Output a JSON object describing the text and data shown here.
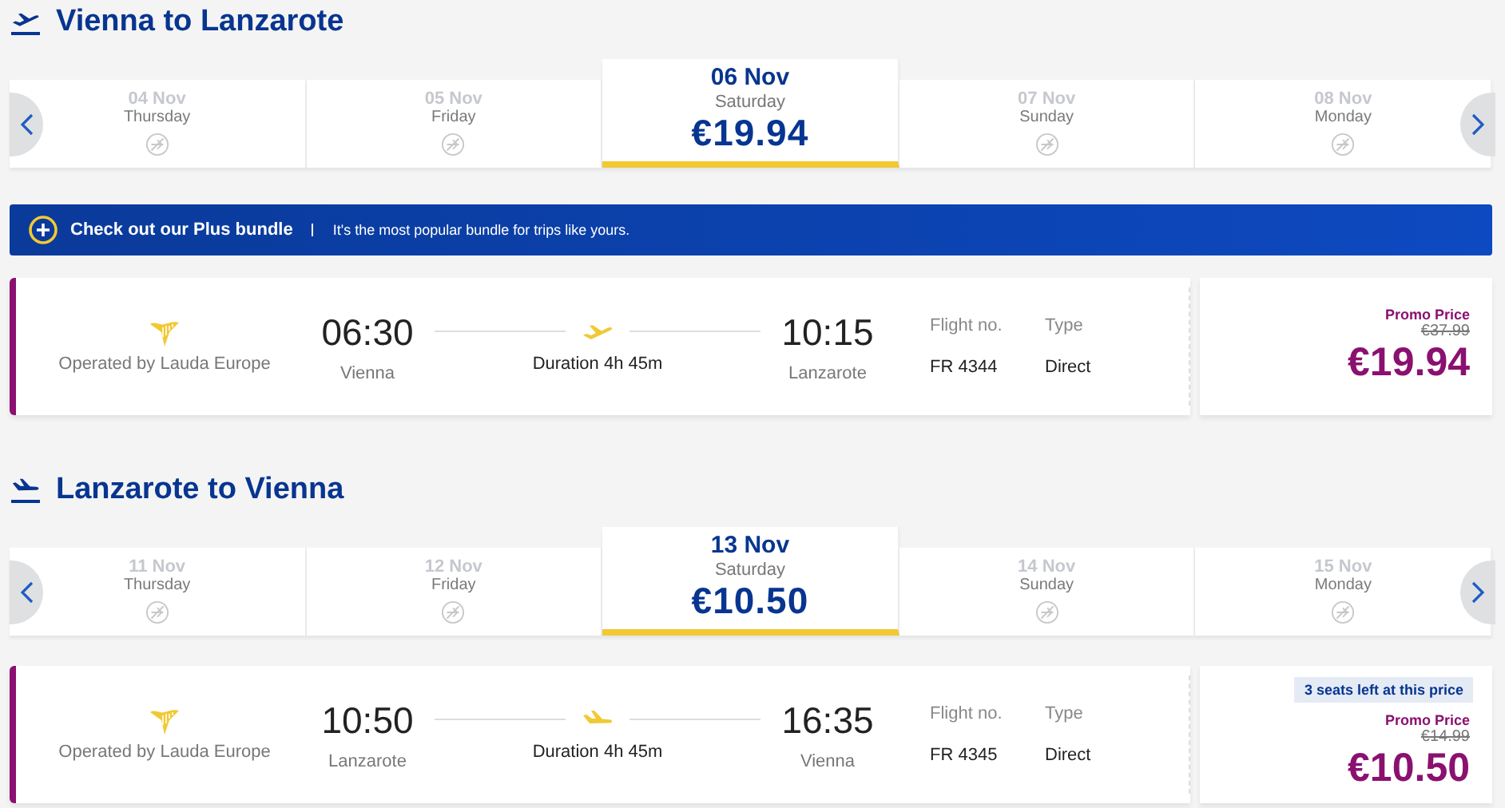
{
  "sections": [
    {
      "kind": "outbound",
      "title": "Vienna to Lanzarote",
      "dates": [
        {
          "date": "04 Nov",
          "day": "Thursday",
          "selected": false
        },
        {
          "date": "05 Nov",
          "day": "Friday",
          "selected": false
        },
        {
          "date": "06 Nov",
          "day": "Saturday",
          "price": "€19.94",
          "selected": true
        },
        {
          "date": "07 Nov",
          "day": "Sunday",
          "selected": false
        },
        {
          "date": "08 Nov",
          "day": "Monday",
          "selected": false
        }
      ],
      "banner": {
        "title": "Check out our Plus bundle",
        "text": "It's the most popular bundle for trips like yours."
      },
      "flight": {
        "operator": "Operated by Lauda Europe",
        "departure_time": "06:30",
        "departure_city": "Vienna",
        "duration": "Duration 4h 45m",
        "arrival_time": "10:15",
        "arrival_city": "Lanzarote",
        "flight_no_label": "Flight no.",
        "flight_no": "FR 4344",
        "type_label": "Type",
        "type": "Direct",
        "promo_label": "Promo Price",
        "old_price": "€37.99",
        "price": "€19.94"
      }
    },
    {
      "kind": "return",
      "title": "Lanzarote to Vienna",
      "dates": [
        {
          "date": "11 Nov",
          "day": "Thursday",
          "selected": false
        },
        {
          "date": "12 Nov",
          "day": "Friday",
          "selected": false
        },
        {
          "date": "13 Nov",
          "day": "Saturday",
          "price": "€10.50",
          "selected": true
        },
        {
          "date": "14 Nov",
          "day": "Sunday",
          "selected": false
        },
        {
          "date": "15 Nov",
          "day": "Monday",
          "selected": false
        }
      ],
      "flight": {
        "operator": "Operated by Lauda Europe",
        "departure_time": "10:50",
        "departure_city": "Lanzarote",
        "duration": "Duration 4h 45m",
        "arrival_time": "16:35",
        "arrival_city": "Vienna",
        "flight_no_label": "Flight no.",
        "flight_no": "FR 4345",
        "type_label": "Type",
        "type": "Direct",
        "badge": "3 seats left at this price",
        "promo_label": "Promo Price",
        "old_price": "€14.99",
        "price": "€10.50"
      }
    }
  ]
}
